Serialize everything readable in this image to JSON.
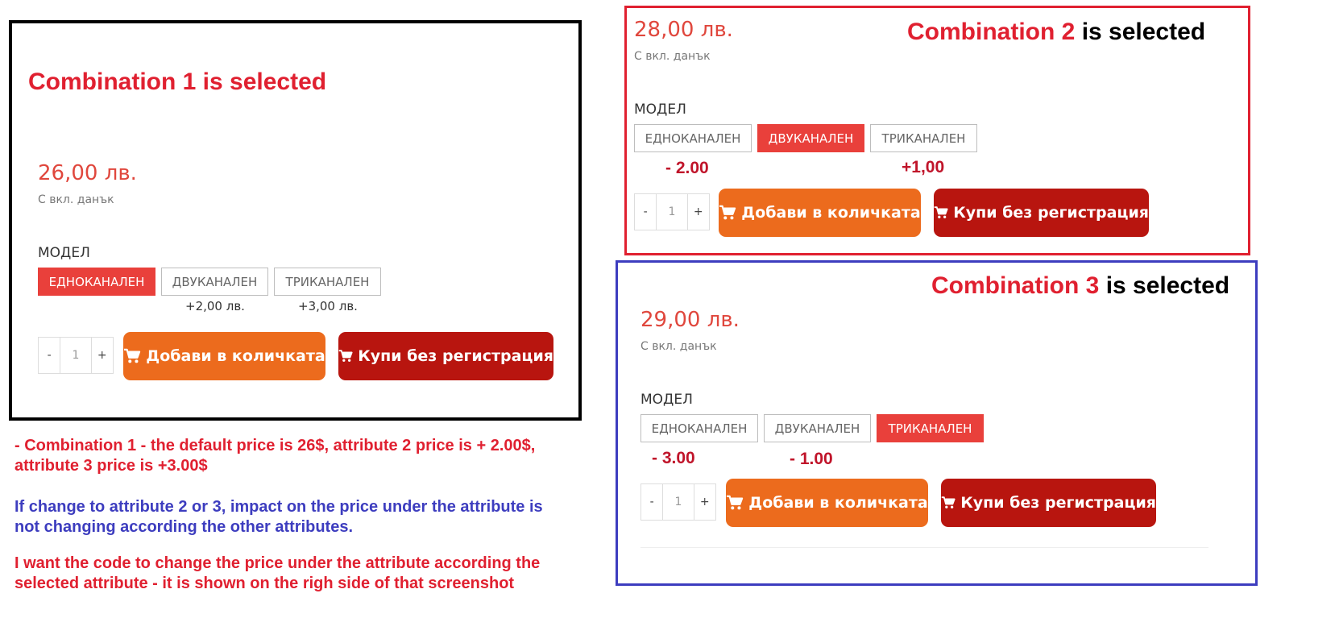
{
  "panel1": {
    "heading": "Combination 1 is selected",
    "price": "26,00 лв.",
    "vat": "С вкл. данък",
    "model_label": "МОДЕЛ",
    "options": [
      {
        "label": "ЕДНОКАНАЛЕН",
        "selected": true
      },
      {
        "label": "ДВУКАНАЛЕН",
        "selected": false
      },
      {
        "label": "ТРИКАНАЛЕН",
        "selected": false
      }
    ],
    "deltas": [
      "+2,00 лв.",
      "+3,00 лв."
    ],
    "qty": {
      "minus": "-",
      "value": "1",
      "plus": "+"
    },
    "add_button": "Добави в количката",
    "buy_button": "Купи без регистрация"
  },
  "panel2": {
    "heading_num": "Combination 2",
    "heading_rest": "is selected",
    "price": "28,00 лв.",
    "vat": "С вкл. данък",
    "model_label": "МОДЕЛ",
    "options": [
      {
        "label": "ЕДНОКАНАЛЕН",
        "selected": false
      },
      {
        "label": "ДВУКАНАЛЕН",
        "selected": true
      },
      {
        "label": "ТРИКАНАЛЕН",
        "selected": false
      }
    ],
    "deltas": [
      "- 2.00",
      "+1,00"
    ],
    "qty": {
      "minus": "-",
      "value": "1",
      "plus": "+"
    },
    "add_button": "Добави в количката",
    "buy_button": "Купи без регистрация"
  },
  "panel3": {
    "heading_num": "Combination 3",
    "heading_rest": "is selected",
    "price": "29,00 лв.",
    "vat": "С вкл. данък",
    "model_label": "МОДЕЛ",
    "options": [
      {
        "label": "ЕДНОКАНАЛЕН",
        "selected": false
      },
      {
        "label": "ДВУКАНАЛЕН",
        "selected": false
      },
      {
        "label": "ТРИКАНАЛЕН",
        "selected": true
      }
    ],
    "deltas": [
      "- 3.00",
      "- 1.00"
    ],
    "qty": {
      "minus": "-",
      "value": "1",
      "plus": "+"
    },
    "add_button": "Добави в количката",
    "buy_button": "Купи без регистрация"
  },
  "notes": {
    "line1a": "- Combination 1 - the default price is 26$, attribute 2 price is + 2.00$,",
    "line1b": "attribute 3 price is +3.00$",
    "line2a": "If change to attribute 2 or 3, impact on the price under the attribute is",
    "line2b": "not changing according the other attributes.",
    "line3a": "I want the code to change the price under the attribute according the",
    "line3b": "selected attribute - it is shown on the righ side of that screenshot"
  },
  "icons": {
    "cart": "shopping-cart-icon"
  },
  "colors": {
    "selected_option": "#e9403b",
    "add_button": "#ec6b1d",
    "buy_button": "#b8150f",
    "price": "#e0473d",
    "annotation_red": "#e02030",
    "annotation_blue": "#3d3dbf"
  }
}
